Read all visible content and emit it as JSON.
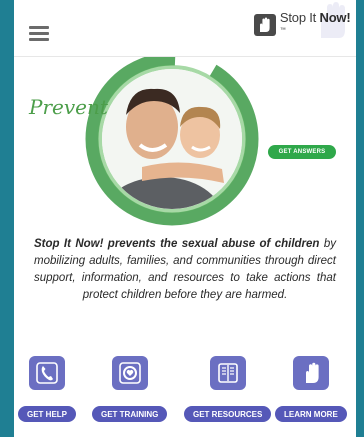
{
  "header": {
    "logo_text_plain": "Stop It ",
    "logo_text_bold": "Now!",
    "logo_mark": "™"
  },
  "hero": {
    "overlay_word": "Prevent",
    "cta_label": "GET ANSWERS"
  },
  "mission": {
    "lead": "Stop It Now! prevents the sexual abuse of children",
    "body": "by mobilizing adults, families, and communities through direct support, information, and resources to take actions that protect children before they are harmed."
  },
  "nav": {
    "items": [
      {
        "label": "GET HELP",
        "icon": "phone-icon"
      },
      {
        "label": "GET TRAINING",
        "icon": "target-icon"
      },
      {
        "label": "GET RESOURCES",
        "icon": "book-icon"
      },
      {
        "label": "LEARN MORE",
        "icon": "hand-icon"
      }
    ]
  },
  "colors": {
    "frame": "#1f7f93",
    "nav_purple": "#5558b8",
    "icon_purple": "#6b6fc2",
    "cta_green": "#2fa84a",
    "prevent_green": "#4c9e4a"
  }
}
